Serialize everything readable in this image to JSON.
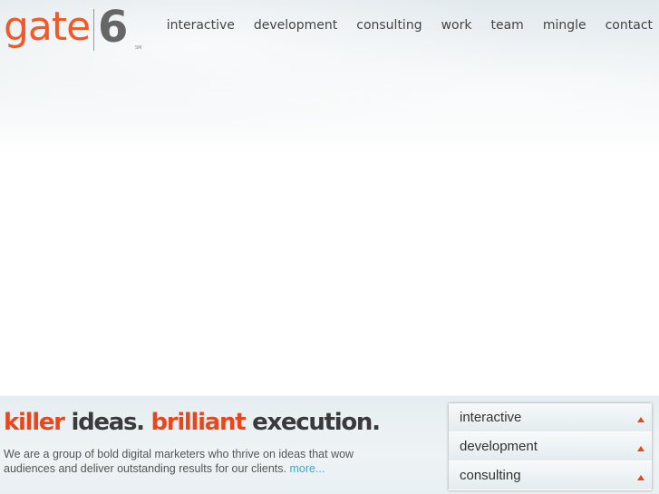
{
  "logo": {
    "word": "gate",
    "number": "6",
    "mark": "SM"
  },
  "nav": [
    "interactive",
    "development",
    "consulting",
    "work",
    "team",
    "mingle",
    "contact"
  ],
  "tagline": {
    "w1": "killer",
    "w2": "ideas.",
    "w3": "brilliant",
    "w4": "execution."
  },
  "description": "We are a group of bold digital marketers who thrive on ideas that wow audiences and deliver outstanding results for our clients.",
  "more_link": "more...",
  "services": [
    "interactive",
    "development",
    "consulting"
  ],
  "colors": {
    "accent": "#e8471c",
    "link": "#4aa3c7"
  }
}
